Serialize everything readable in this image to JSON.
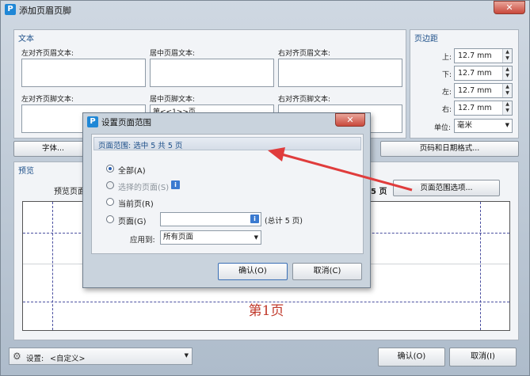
{
  "window": {
    "title": "添加页眉页脚",
    "close": "✕"
  },
  "text_group": {
    "label": "文本",
    "left_header": "左对齐页眉文本:",
    "center_header": "居中页眉文本:",
    "right_header": "右对齐页眉文本:",
    "left_footer": "左对齐页脚文本:",
    "center_footer": "居中页脚文本:",
    "center_footer_value": "第<<1>>页",
    "right_footer": "右对齐页脚文本:"
  },
  "margins": {
    "label": "页边距",
    "top_label": "上:",
    "top": "12.7 mm",
    "bottom_label": "下:",
    "bottom": "12.7 mm",
    "left_label": "左:",
    "left": "12.7 mm",
    "right_label": "右:",
    "right": "12.7 mm",
    "unit_label": "单位:",
    "unit": "毫米"
  },
  "buttons": {
    "font": "字体...",
    "page_date_format": "页码和日期格式...",
    "page_range_options": "页面范围选项..."
  },
  "preview": {
    "label": "预览",
    "preview_page": "预览页面",
    "page_count": "5 页",
    "page_text": "第1页"
  },
  "footer": {
    "settings_label": "设置:",
    "settings_value": "<自定义>",
    "ok": "确认(O)",
    "cancel": "取消(I)"
  },
  "dialog": {
    "title": "设置页面范围",
    "range_info": "页面范围: 选中 5 共 5 页",
    "opt_all": "全部(A)",
    "opt_selected": "选择的页面(S)",
    "opt_current": "当前页(R)",
    "opt_pages": "页面(G)",
    "total": "(总计 5 页)",
    "apply_to_label": "应用到:",
    "apply_to_value": "所有页面",
    "ok": "确认(O)",
    "cancel": "取消(C)"
  },
  "icons": [
    "app-icon",
    "info-icon",
    "gear-icon",
    "dropdown-arrow-icon"
  ],
  "colors": {
    "accent": "#1f87d6",
    "page_text": "#c0392b",
    "arrow": "#e03c3c",
    "group_label": "#1d4f89"
  }
}
